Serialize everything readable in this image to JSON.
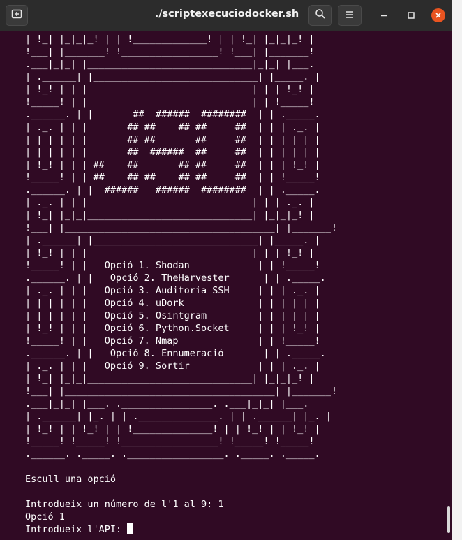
{
  "window": {
    "title": "./scriptexecuciodocker.sh"
  },
  "toolbar": {
    "new_tab_icon": "new-tab-icon",
    "search_icon": "search-icon",
    "menu_icon": "hamburger-menu-icon",
    "minimize_icon": "minimize-icon",
    "maximize_icon": "maximize-icon",
    "close_icon": "close-icon",
    "close_color": "#e95420"
  },
  "terminal": {
    "background": "#300a24",
    "lines": [
      "| !_| |_|_|_! | | !_____________! | | !_| |_|_|_! |",
      "!___| |_______! !_________________! !___| |_______!",
      ".___|_|_| |_____________________________|_|_| |___.",
      "| .______| |_____________________________| |_____. |",
      "| !_! | | |                             | | | !_! |",
      "!_____! | |                             | | !_____!",
      ".______. | |       ##  ######  ########  | | ._____.",
      "| ._. | | |       ## ##    ## ##     ##  | | | ._. |",
      "| | | | | |       ## ##       ##     ##  | | | | | |",
      "| | | | | |       ##  ######  ##     ##  | | | | | |",
      "| !_! | | | ##    ##       ## ##     ##  | | | !_! |",
      "!_____! | | ##    ## ##    ## ##     ##  | | !_____!",
      ".______. | |  ######   ######  ########  | | ._____.",
      "| ._. | | |                             | | | ._. |",
      "| !_| |_|_|_____________________________| |_|_|_! |",
      "!___| |_____________________________________| |_______!",
      "| .______| |_____________________________| |_____. |",
      "| !_! | | |                             | | | !_! |",
      "!_____! | |   Opció 1. Shodan            | | !_____!",
      ".______. | |   Opció 2. TheHarvester      | | ._____.",
      "| ._. | | |   Opció 3. Auditoria SSH     | | | ._. |",
      "| | | | | |   Opció 4. uDork             | | | | | |",
      "| | | | | |   Opció 5. Osintgram         | | | | | |",
      "| !_! | | |   Opció 6. Python.Socket     | | | !_! |",
      "!_____! | |   Opció 7. Nmap              | | !_____!",
      ".______. | |   Opció 8. Ennumeració       | | ._____.",
      "| ._. | | |   Opció 9. Sortir            | | | ._. |",
      "| !_| |_|_|_____________________________| |_|_|_! |",
      "!___| |_____________________________________| |_______!",
      ".___|_|_| |___. .________________. .___|_|_| |___.",
      "| .______| |_. | | .______________. | | .______| |_. |",
      "| !_! | | !_! | | !______________! | | !_! | | !_! |",
      "!_____! !_____! !_________________! !_____! !_____!",
      ".______. ._____. ._________________. ._____. ._____.",
      "",
      "Escull una opció",
      "",
      "Introdueix un número de l'1 al 9: 1",
      "Opció 1",
      "Introdueix l'API: "
    ]
  }
}
